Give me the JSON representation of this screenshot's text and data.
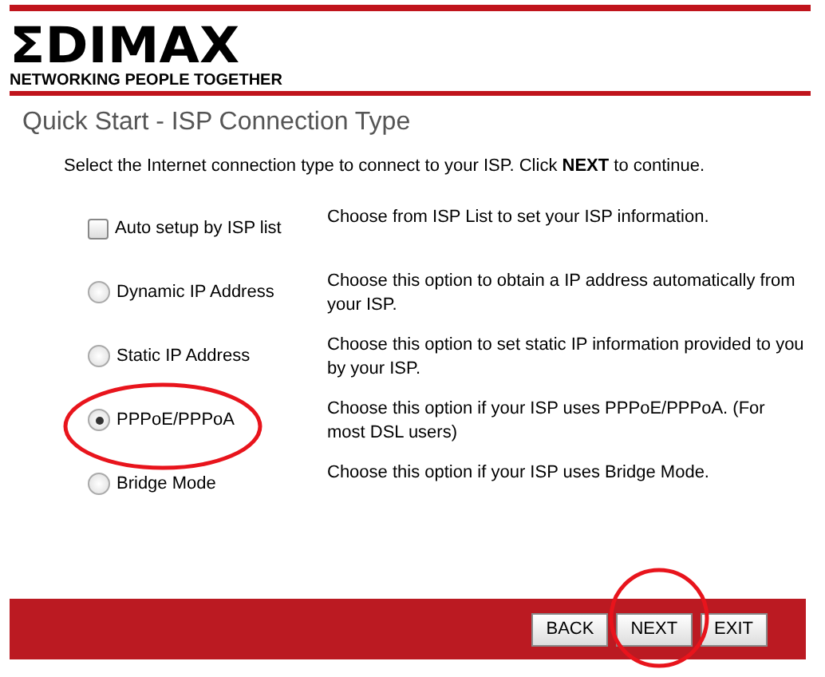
{
  "header": {
    "logo": "ΣDIMAX",
    "tagline": "NETWORKING PEOPLE TOGETHER"
  },
  "title": "Quick Start - ISP Connection Type",
  "instruction": "Select the Internet connection type to connect to your ISP. Click **NEXT** to continue.",
  "options": [
    {
      "kind": "checkbox",
      "label": "Auto setup by ISP list",
      "checked": false,
      "description": "Choose from ISP List to set your ISP information."
    },
    {
      "kind": "radio",
      "label": "Dynamic IP Address",
      "selected": false,
      "description": "Choose this option to obtain a IP address automatically from your ISP."
    },
    {
      "kind": "radio",
      "label": "Static IP Address",
      "selected": false,
      "description": "Choose this option to set static IP information provided to you by your ISP."
    },
    {
      "kind": "radio",
      "label": "PPPoE/PPPoA",
      "selected": true,
      "description": "Choose this option if your ISP uses PPPoE/PPPoA. (For most DSL users)"
    },
    {
      "kind": "radio",
      "label": "Bridge Mode",
      "selected": false,
      "description": "Choose this option if your ISP uses Bridge Mode."
    }
  ],
  "buttons": [
    "BACK",
    "NEXT",
    "EXIT"
  ]
}
